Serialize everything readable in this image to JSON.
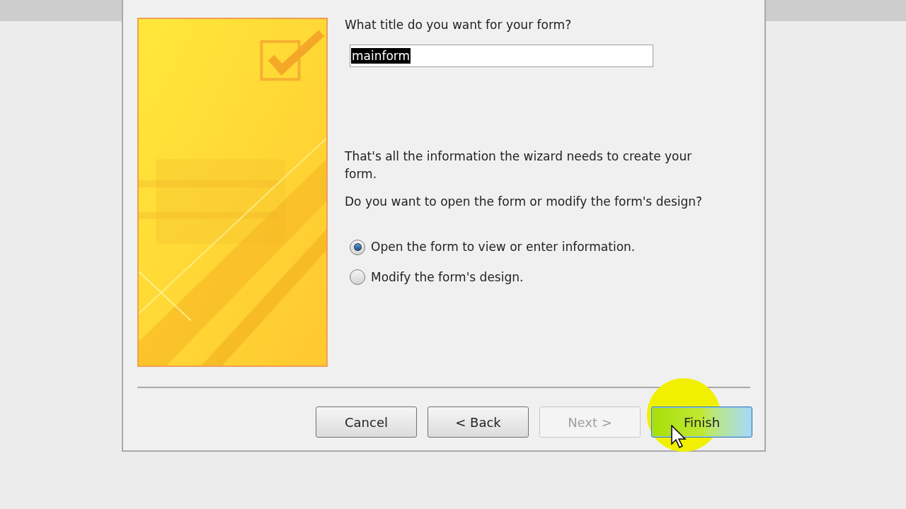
{
  "prompt": "What title do you want for your form?",
  "title_field": {
    "value": "mainform",
    "text_selected": true
  },
  "info": "That's all the information the wizard needs to create your form.",
  "question": "Do you want to open the form or modify the form's design?",
  "options": [
    {
      "label": "Open the form to view or enter information.",
      "selected": true
    },
    {
      "label": "Modify the form's design.",
      "selected": false
    }
  ],
  "buttons": [
    {
      "label": "Cancel",
      "disabled": false,
      "focused": false
    },
    {
      "label": "< Back",
      "disabled": false,
      "focused": false
    },
    {
      "label": "Next >",
      "disabled": true,
      "focused": false
    },
    {
      "label": "Finish",
      "disabled": false,
      "focused": true
    }
  ]
}
